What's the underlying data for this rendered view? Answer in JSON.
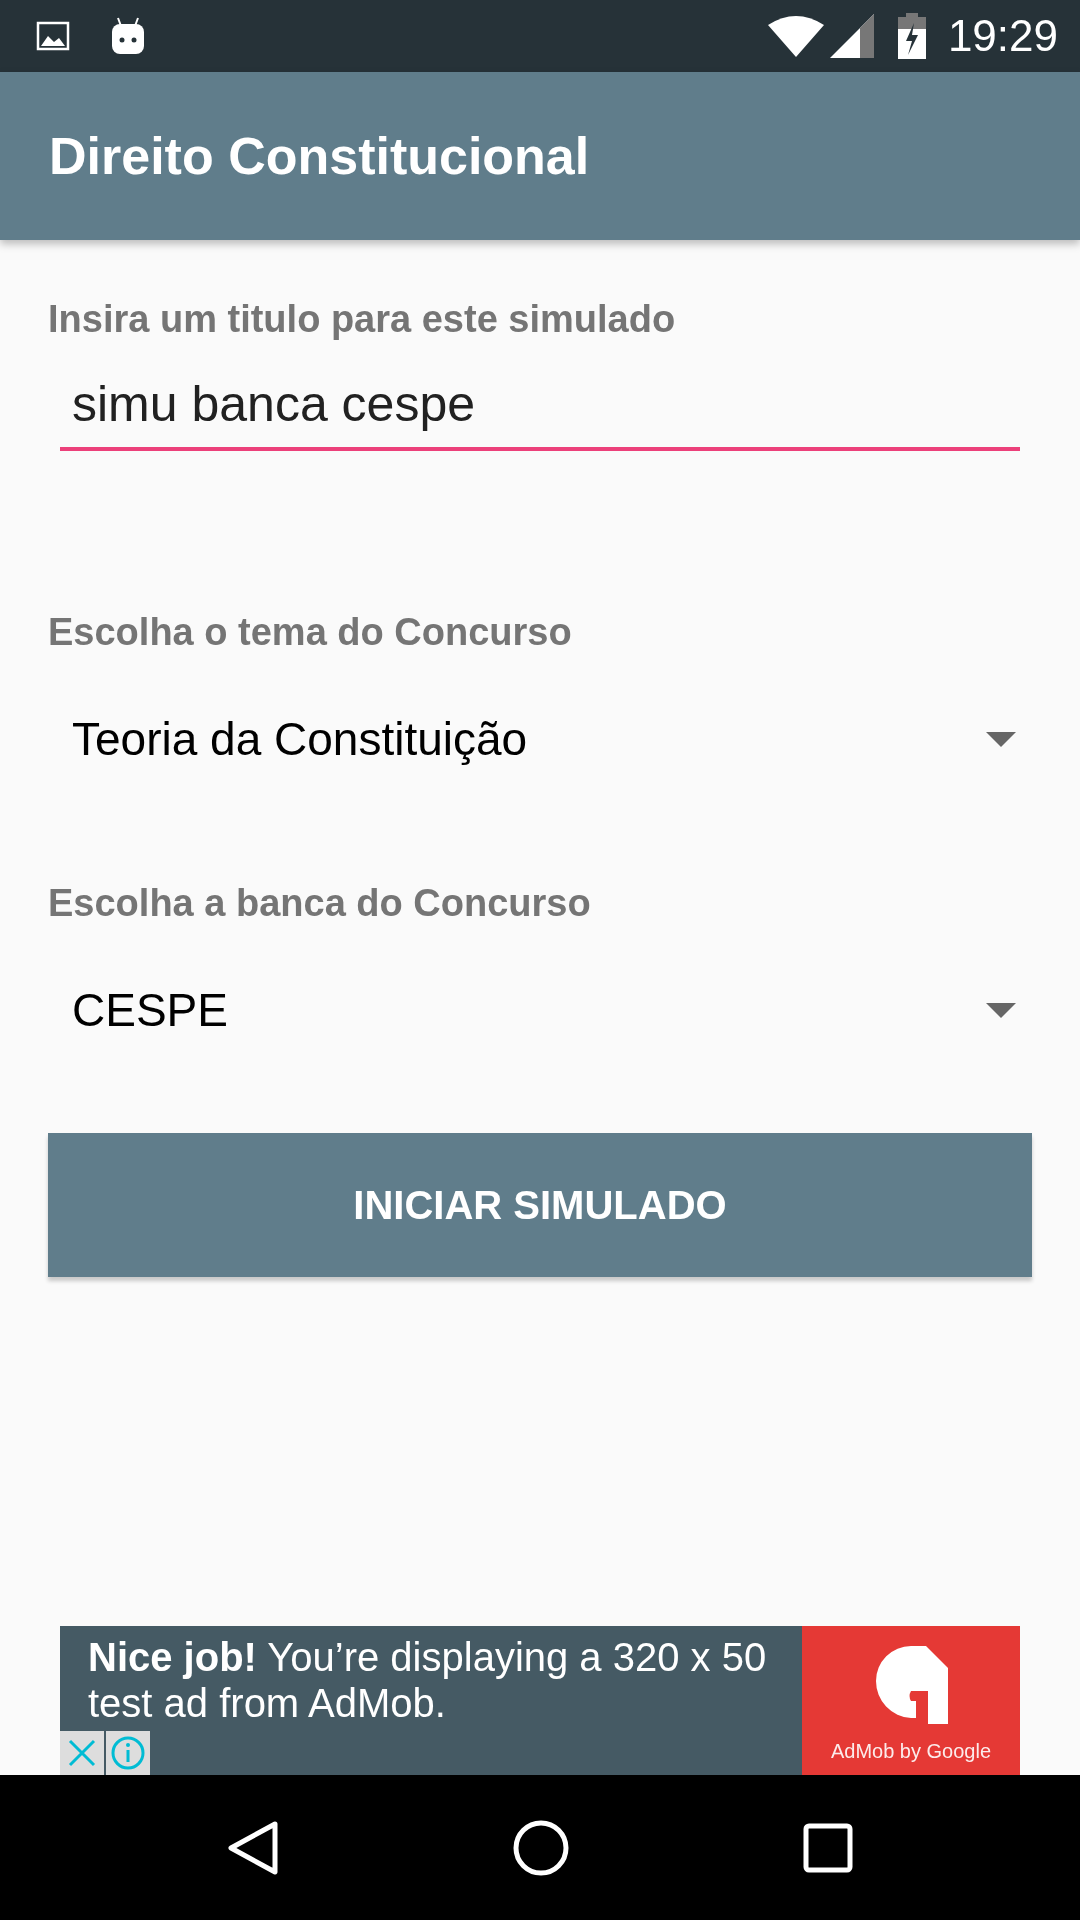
{
  "status_bar": {
    "time": "19:29"
  },
  "app_bar": {
    "title": "Direito Constitucional"
  },
  "form": {
    "title_label": "Insira um titulo para este simulado",
    "title_value": "simu banca cespe",
    "spinners": [
      {
        "label": "Escolha o tema do Concurso",
        "value": "Teoria da Constituição"
      },
      {
        "label": "Escolha a banca do Concurso",
        "value": "CESPE"
      }
    ],
    "button": "INICIAR SIMULADO"
  },
  "ad": {
    "text": "**Nice job!** You’re displaying a 320 x 50 test ad from AdMob.",
    "brand": "AdMob by Google"
  }
}
